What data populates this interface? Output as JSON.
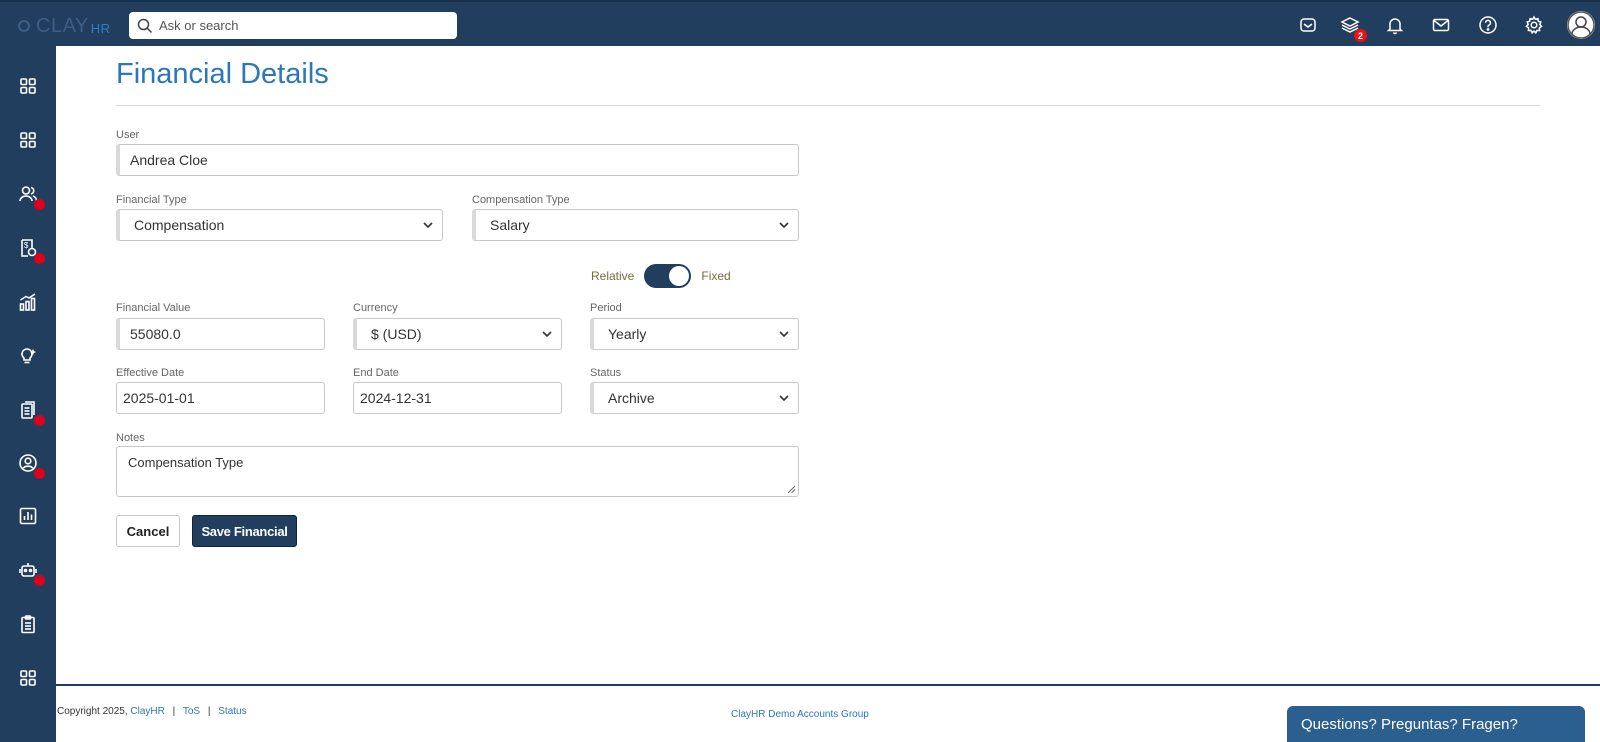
{
  "app": {
    "logo_text": "CLAY",
    "logo_suffix": "HR"
  },
  "search": {
    "placeholder": "Ask or search"
  },
  "topbar": {
    "notification_badge": "2",
    "icons": [
      "inbox-icon",
      "layers-icon",
      "bell-icon",
      "mail-icon",
      "help-icon",
      "settings-icon",
      "user-avatar-icon"
    ]
  },
  "sidebar": {
    "items": [
      {
        "icon": "grid-icon",
        "has_dot": false
      },
      {
        "icon": "grid-icon",
        "has_dot": false
      },
      {
        "icon": "people-icon",
        "has_dot": true
      },
      {
        "icon": "payroll-icon",
        "has_dot": true
      },
      {
        "icon": "chart-growth-icon",
        "has_dot": false
      },
      {
        "icon": "lightbulb-icon",
        "has_dot": false
      },
      {
        "icon": "documents-icon",
        "has_dot": true
      },
      {
        "icon": "user-circle-icon",
        "has_dot": true
      },
      {
        "icon": "report-icon",
        "has_dot": false
      },
      {
        "icon": "bot-icon",
        "has_dot": true
      },
      {
        "icon": "clipboard-icon",
        "has_dot": false
      },
      {
        "icon": "grid-icon",
        "has_dot": false
      }
    ]
  },
  "page": {
    "title": "Financial Details"
  },
  "form": {
    "user": {
      "label": "User",
      "value": "Andrea Cloe"
    },
    "financial_type": {
      "label": "Financial Type",
      "value": "Compensation"
    },
    "compensation_type": {
      "label": "Compensation Type",
      "value": "Salary"
    },
    "toggle": {
      "left_label": "Relative",
      "right_label": "Fixed",
      "state": "Fixed"
    },
    "financial_value": {
      "label": "Financial Value",
      "value": "55080.0"
    },
    "currency": {
      "label": "Currency",
      "value": "$ (USD)"
    },
    "period": {
      "label": "Period",
      "value": "Yearly"
    },
    "effective_date": {
      "label": "Effective Date",
      "value": "2025-01-01"
    },
    "end_date": {
      "label": "End Date",
      "value": "2024-12-31"
    },
    "status": {
      "label": "Status",
      "value": "Archive"
    },
    "notes": {
      "label": "Notes",
      "value": "Compensation Type"
    },
    "cancel_label": "Cancel",
    "save_label": "Save Financial"
  },
  "footer": {
    "copyright": "Copyright 2025,",
    "brand_link": "ClayHR",
    "tos_link": "ToS",
    "status_link": "Status",
    "separator": "|",
    "group_name": "ClayHR Demo Accounts Group",
    "chat_label": "Questions? Preguntas? Fragen?"
  },
  "colors": {
    "navy": "#213e5f",
    "title_blue": "#2b77ba",
    "dot_red": "#e0001b"
  }
}
